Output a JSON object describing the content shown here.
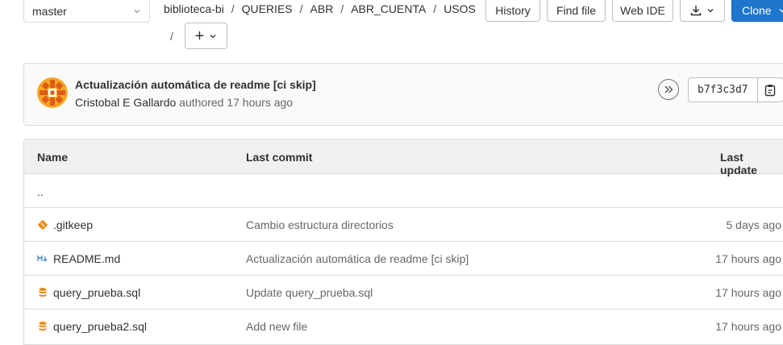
{
  "branch": {
    "name": "master"
  },
  "breadcrumb": [
    "biblioteca-bi",
    "QUERIES",
    "ABR",
    "ABR_CUENTA",
    "USOS"
  ],
  "breadcrumb_separator": "/",
  "add_button": {
    "label": "+"
  },
  "toolbar": {
    "history": "History",
    "find_file": "Find file",
    "web_ide": "Web IDE",
    "clone": "Clone"
  },
  "last_commit": {
    "title": "Actualización automática de readme [ci skip]",
    "author": "Cristobal E Gallardo",
    "verb": "authored",
    "time": "17 hours ago",
    "sha": "b7f3c3d7"
  },
  "table": {
    "headers": {
      "name": "Name",
      "last_commit": "Last commit",
      "last_update": "Last update"
    },
    "parent_dir": "..",
    "rows": [
      {
        "icon": "git-file-icon",
        "name": ".gitkeep",
        "commit": "Cambio estructura directorios",
        "updated": "5 days ago"
      },
      {
        "icon": "markdown-icon",
        "name": "README.md",
        "commit": "Actualización automática de readme [ci skip]",
        "updated": "17 hours ago"
      },
      {
        "icon": "database-icon",
        "name": "query_prueba.sql",
        "commit": "Update query_prueba.sql",
        "updated": "17 hours ago"
      },
      {
        "icon": "database-icon",
        "name": "query_prueba2.sql",
        "commit": "Add new file",
        "updated": "17 hours ago"
      }
    ]
  },
  "colors": {
    "accent": "#1f75cb",
    "file_icon": "#e58a13",
    "markdown_icon": "#5e90c9"
  }
}
